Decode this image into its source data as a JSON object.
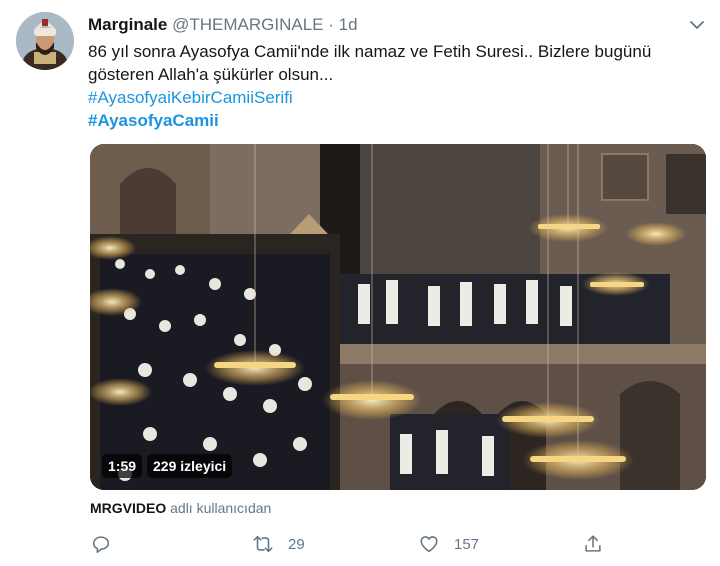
{
  "tweet": {
    "display_name": "Marginale",
    "handle": "@THEMARGINALE",
    "separator": "·",
    "time": "1d",
    "text_line1": "86 yıl sonra Ayasofya Camii'nde ilk namaz ve Fetih Suresi.. Bizlere bugünü",
    "text_line2": "gösteren Allah'a şükürler olsun...",
    "hashtag1": "#AyasofyaiKebirCamiiSerifi",
    "hashtag2": "#AyasofyaCamii"
  },
  "media": {
    "duration": "1:59",
    "views": "229 izleyici"
  },
  "attribution": {
    "source": "MRGVIDEO",
    "suffix": "adlı kullanıcıdan"
  },
  "actions": {
    "reply_icon": "reply-icon",
    "retweet_icon": "retweet-icon",
    "retweet_count": "29",
    "like_icon": "heart-icon",
    "like_count": "157",
    "share_icon": "share-icon"
  },
  "colors": {
    "link": "#1b95e0",
    "secondary_text": "#657786"
  }
}
